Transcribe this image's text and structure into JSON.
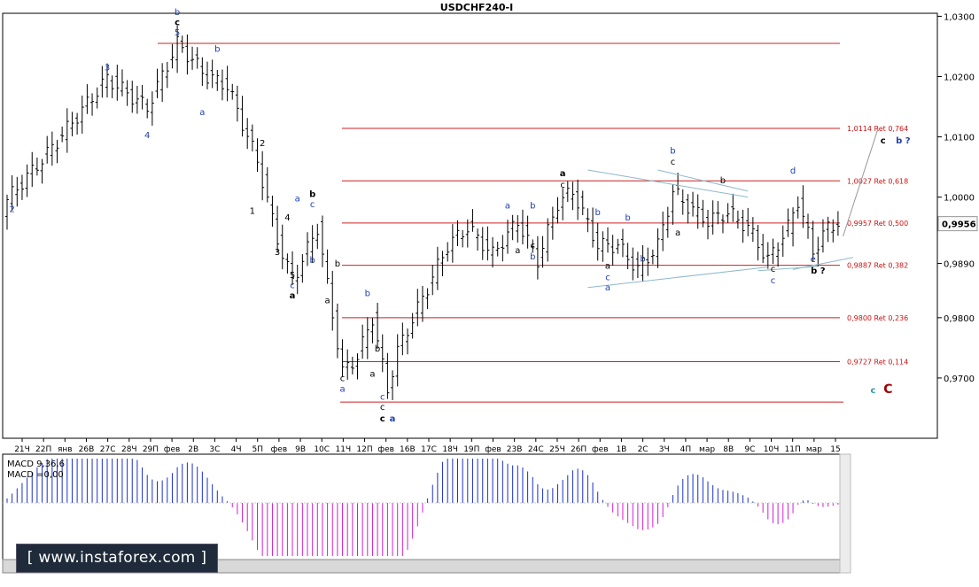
{
  "chart_data": {
    "type": "candlestick",
    "title": "USDCHF240-I",
    "y_axis": {
      "min": 0.96,
      "max": 1.0305,
      "ticks": [
        0.97,
        0.98,
        0.989,
        1.0,
        1.01,
        1.02,
        1.03
      ],
      "tick_labels": [
        "0,9700",
        "0,9800",
        "0,9890",
        "1,0000",
        "1,0100",
        "1,0200",
        "1,0300"
      ],
      "current_price": 0.9956,
      "current_label": "0,9956"
    },
    "x_axis": {
      "labels": [
        "21Ч",
        "22П",
        "янв",
        "26В",
        "27С",
        "28Ч",
        "29П",
        "фев",
        "2В",
        "3С",
        "4Ч",
        "5П",
        "фев",
        "9В",
        "10С",
        "11Ч",
        "12П",
        "фев",
        "16В",
        "17С",
        "18Ч",
        "19П",
        "фев",
        "23В",
        "24С",
        "25Ч",
        "26П",
        "фев",
        "1В",
        "2С",
        "3Ч",
        "4П",
        "мар",
        "8В",
        "9С",
        "10Ч",
        "11П",
        "мар",
        "15"
      ]
    },
    "fib_levels": [
      {
        "value": 1.0255,
        "label": ""
      },
      {
        "value": 1.0114,
        "label": "1,0114 Ret 0,764"
      },
      {
        "value": 1.0027,
        "label": "1,0027 Ret 0,618"
      },
      {
        "value": 0.9957,
        "label": "0,9957 Ret 0,500"
      },
      {
        "value": 0.9887,
        "label": "0,9887 Ret 0,382"
      },
      {
        "value": 0.98,
        "label": "0,9800 Ret 0,236"
      },
      {
        "value": 0.9727,
        "label": "0,9727 Ret 0,114"
      },
      {
        "value": 0.966,
        "label": ""
      }
    ],
    "wave_labels": [
      {
        "text": "b",
        "i": 34,
        "v": 1.0302,
        "color": "#1f3fb0"
      },
      {
        "text": "c",
        "i": 34,
        "v": 1.0285,
        "color": "#000000",
        "bold": true
      },
      {
        "text": "5",
        "i": 34,
        "v": 1.0268,
        "color": "#1f3fb0"
      },
      {
        "text": "3",
        "i": 20,
        "v": 1.021,
        "color": "#1f3fb0"
      },
      {
        "text": "4",
        "i": 28,
        "v": 1.0098,
        "color": "#1f3fb0"
      },
      {
        "text": "2",
        "i": 1,
        "v": 0.9975,
        "color": "#1f3fb0"
      },
      {
        "text": "b",
        "i": 42,
        "v": 1.0241,
        "color": "#1f3fb0"
      },
      {
        "text": "a",
        "i": 39,
        "v": 1.0136,
        "color": "#1f3fb0"
      },
      {
        "text": "2",
        "i": 51,
        "v": 1.0085,
        "color": "#000000"
      },
      {
        "text": "1",
        "i": 49,
        "v": 0.9972,
        "color": "#000000"
      },
      {
        "text": "4",
        "i": 56,
        "v": 0.9961,
        "color": "#000000"
      },
      {
        "text": "3",
        "i": 54,
        "v": 0.9904,
        "color": "#000000"
      },
      {
        "text": "a",
        "i": 58,
        "v": 0.9993,
        "color": "#1f3fb0"
      },
      {
        "text": "b",
        "i": 61,
        "v": 1.0,
        "color": "#000000",
        "bold": true
      },
      {
        "text": "c",
        "i": 61,
        "v": 0.9983,
        "color": "#1f3fb0"
      },
      {
        "text": "b",
        "i": 61,
        "v": 0.9891,
        "color": "#1f3fb0"
      },
      {
        "text": "5",
        "i": 57,
        "v": 0.9866,
        "color": "#000000"
      },
      {
        "text": "c",
        "i": 57,
        "v": 0.9849,
        "color": "#1f3fb0"
      },
      {
        "text": "a",
        "i": 57,
        "v": 0.9832,
        "color": "#000000",
        "bold": true
      },
      {
        "text": "b",
        "i": 66,
        "v": 0.9885,
        "color": "#000000"
      },
      {
        "text": "a",
        "i": 64,
        "v": 0.9824,
        "color": "#000000"
      },
      {
        "text": "b",
        "i": 72,
        "v": 0.9836,
        "color": "#1f3fb0"
      },
      {
        "text": "c",
        "i": 67,
        "v": 0.9695,
        "color": "#000000"
      },
      {
        "text": "a",
        "i": 67,
        "v": 0.9677,
        "color": "#1f3fb0"
      },
      {
        "text": "b",
        "i": 74,
        "v": 0.9744,
        "color": "#000000"
      },
      {
        "text": "a",
        "i": 73,
        "v": 0.9702,
        "color": "#000000"
      },
      {
        "text": "c",
        "i": 75,
        "v": 0.9664,
        "color": "#1f3fb0"
      },
      {
        "text": "c",
        "i": 75,
        "v": 0.9647,
        "color": "#000000"
      },
      {
        "text": "c",
        "i": 75,
        "v": 0.9628,
        "color": "#000000",
        "bold": true
      },
      {
        "text": "a",
        "i": 77,
        "v": 0.9628,
        "color": "#1f3fb0",
        "bold": true
      },
      {
        "text": "a",
        "i": 100,
        "v": 0.9981,
        "color": "#1f3fb0"
      },
      {
        "text": "b",
        "i": 105,
        "v": 0.9981,
        "color": "#1f3fb0"
      },
      {
        "text": "a",
        "i": 102,
        "v": 0.9907,
        "color": "#000000"
      },
      {
        "text": "c",
        "i": 105,
        "v": 0.9915,
        "color": "#000000"
      },
      {
        "text": "b",
        "i": 105,
        "v": 0.9897,
        "color": "#1f3fb0"
      },
      {
        "text": "a",
        "i": 111,
        "v": 1.0035,
        "color": "#000000",
        "bold": true
      },
      {
        "text": "c",
        "i": 111,
        "v": 1.0016,
        "color": "#000000"
      },
      {
        "text": "b",
        "i": 118,
        "v": 0.997,
        "color": "#1f3fb0"
      },
      {
        "text": "a",
        "i": 120,
        "v": 0.9881,
        "color": "#000000"
      },
      {
        "text": "c",
        "i": 120,
        "v": 0.9862,
        "color": "#1f3fb0"
      },
      {
        "text": "a",
        "i": 120,
        "v": 0.9845,
        "color": "#1f3fb0"
      },
      {
        "text": "b",
        "i": 124,
        "v": 0.9961,
        "color": "#1f3fb0"
      },
      {
        "text": "b",
        "i": 127,
        "v": 0.9893,
        "color": "#1f3fb0"
      },
      {
        "text": "a",
        "i": 134,
        "v": 0.9936,
        "color": "#000000"
      },
      {
        "text": "b",
        "i": 133,
        "v": 1.0072,
        "color": "#1f3fb0"
      },
      {
        "text": "c",
        "i": 133,
        "v": 1.0054,
        "color": "#000000"
      },
      {
        "text": "b",
        "i": 143,
        "v": 1.0023,
        "color": "#000000"
      },
      {
        "text": "c",
        "i": 153,
        "v": 0.9876,
        "color": "#000000"
      },
      {
        "text": "c",
        "i": 153,
        "v": 0.9857,
        "color": "#1f3fb0"
      },
      {
        "text": "d",
        "i": 157,
        "v": 1.0039,
        "color": "#1f3fb0"
      },
      {
        "text": "e",
        "i": 161,
        "v": 0.9892,
        "color": "#1f3fb0"
      },
      {
        "text": "b ?",
        "i": 162,
        "v": 0.9873,
        "color": "#000000",
        "bold": true
      },
      {
        "text": "c",
        "i": 175,
        "v": 1.0089,
        "color": "#000000",
        "bold": true
      },
      {
        "text": "b ?",
        "i": 179,
        "v": 1.0089,
        "color": "#1f3fb0",
        "bold": true
      },
      {
        "text": "c",
        "i": 173,
        "v": 0.9675,
        "color": "#2a9ab0",
        "bold": true
      },
      {
        "text": "C",
        "i": 176,
        "v": 0.9675,
        "color": "#a00000",
        "bold": true,
        "big": true
      }
    ],
    "macd": {
      "label": "MACD 9,36,6",
      "value_label": "MACD =0,00",
      "values": []
    },
    "watermark": "[ www.instaforex.com ]"
  }
}
